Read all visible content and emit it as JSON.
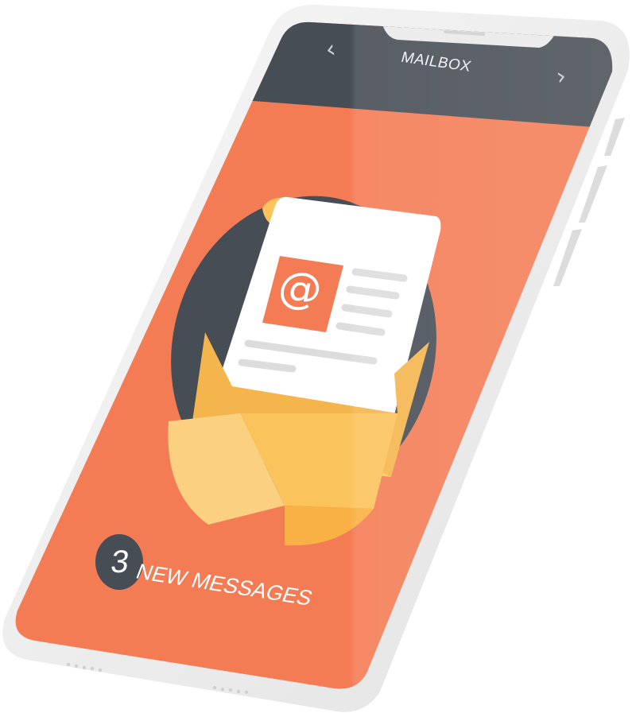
{
  "device": {
    "frame_color": "#ececec",
    "screen_color": "#f47c55",
    "header_color": "#474d55"
  },
  "header": {
    "title": "MAILBOX",
    "back_icon": "chevron-left-icon",
    "forward_icon": "chevron-right-icon",
    "back_glyph": "‹",
    "forward_glyph": "›"
  },
  "illustration": {
    "icon": "envelope-letter-icon",
    "at_symbol": "@",
    "at_icon": "at-icon",
    "envelope_color": "#fbc35c",
    "letter_color": "#ffffff",
    "backdrop_color": "#474d55",
    "accent_color": "#f47c55"
  },
  "notification": {
    "count": "3",
    "label": "NEW MESSAGES",
    "badge_color": "#474d55"
  }
}
